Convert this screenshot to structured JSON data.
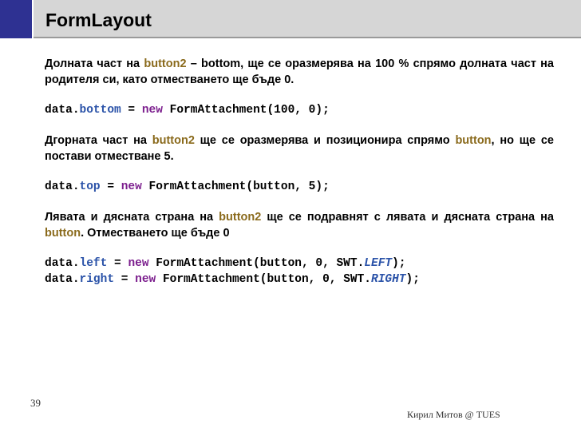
{
  "title": "FormLayout",
  "p1": {
    "a": "Долната част на ",
    "hl": "button2",
    "b": " – bottom, ще се оразмерява на 100 % спрямо долната част на родителя си, като отместването ще бъде 0."
  },
  "code1": {
    "obj": "data",
    "dot": ".",
    "field": "bottom",
    "eq": " = ",
    "kw": "new",
    "rest": " FormAttachment(100, 0);"
  },
  "p2": {
    "a": "Дгорната част на ",
    "hl1": "button2",
    "b": " ще се оразмерява и позиционира спрямо ",
    "hl2": "button",
    "c": ", но ще се постави отместване 5."
  },
  "code2": {
    "obj": "data",
    "dot": ".",
    "field": "top",
    "eq": " = ",
    "kw": "new",
    "rest": " FormAttachment(button, 5);"
  },
  "p3": {
    "a": "Лявата и дясната страна на ",
    "hl1": "button2",
    "b": " ще се подравнят с лявата и дясната страна на ",
    "hl2": "button",
    "c": ". Отместването ще бъде 0"
  },
  "code3": {
    "obj": "data",
    "dot": ".",
    "field": "left",
    "eq": " = ",
    "kw": "new",
    "mid": " FormAttachment(button, 0, SWT.",
    "cst": "LEFT",
    "end": ");"
  },
  "code4": {
    "obj": "data",
    "dot": ".",
    "field": "right",
    "eq": " = ",
    "kw": "new",
    "mid": " FormAttachment(button, 0, SWT.",
    "cst": "RIGHT",
    "end": ");"
  },
  "slide_number": "39",
  "footer": "Кирил Митов @ TUES"
}
